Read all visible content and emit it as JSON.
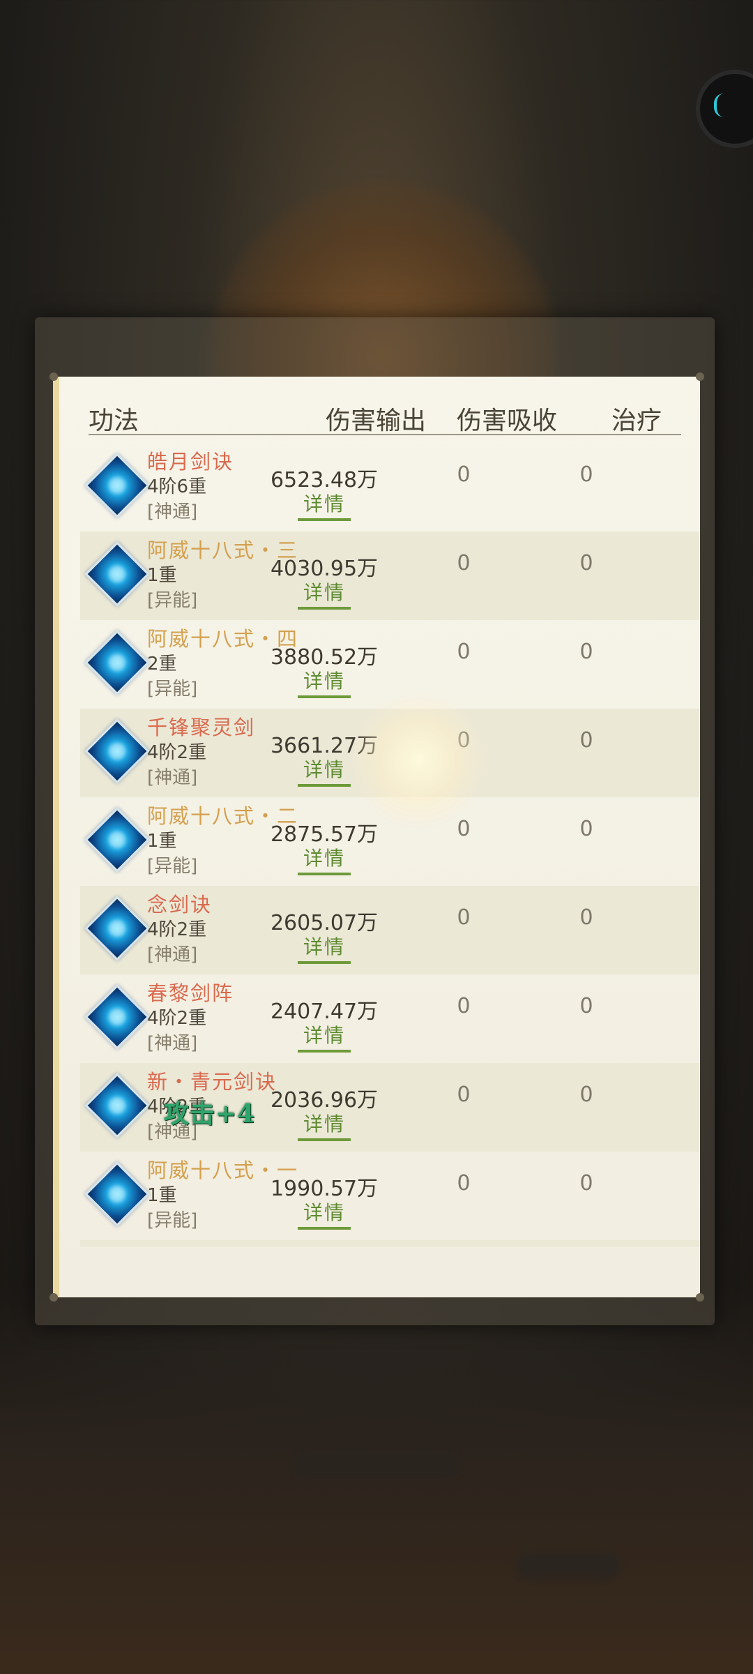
{
  "header": {
    "col_name": "功法",
    "col_damage": "伤害输出",
    "col_absorb": "伤害吸收",
    "col_heal": "治疗"
  },
  "rows": [
    {
      "name": "皓月剑诀",
      "name_color": "red",
      "level": "4阶6重",
      "type": "[神通]",
      "damage": "6523.48万",
      "detail": "详情",
      "absorb": "0",
      "heal": "0"
    },
    {
      "name": "阿威十八式・三",
      "name_color": "gold",
      "level": "1重",
      "type": "[异能]",
      "damage": "4030.95万",
      "detail": "详情",
      "absorb": "0",
      "heal": "0"
    },
    {
      "name": "阿威十八式・四",
      "name_color": "gold",
      "level": "2重",
      "type": "[异能]",
      "damage": "3880.52万",
      "detail": "详情",
      "absorb": "0",
      "heal": "0"
    },
    {
      "name": "千锋聚灵剑",
      "name_color": "red",
      "level": "4阶2重",
      "type": "[神通]",
      "damage": "3661.27万",
      "detail": "详情",
      "absorb": "0",
      "heal": "0"
    },
    {
      "name": "阿威十八式・二",
      "name_color": "gold",
      "level": "1重",
      "type": "[异能]",
      "damage": "2875.57万",
      "detail": "详情",
      "absorb": "0",
      "heal": "0"
    },
    {
      "name": "念剑诀",
      "name_color": "red",
      "level": "4阶2重",
      "type": "[神通]",
      "damage": "2605.07万",
      "detail": "详情",
      "absorb": "0",
      "heal": "0"
    },
    {
      "name": "春黎剑阵",
      "name_color": "red",
      "level": "4阶2重",
      "type": "[神通]",
      "damage": "2407.47万",
      "detail": "详情",
      "absorb": "0",
      "heal": "0"
    },
    {
      "name": "新・青元剑诀",
      "name_color": "red",
      "level": "4阶2重",
      "type": "[神通]",
      "damage": "2036.96万",
      "detail": "详情",
      "absorb": "0",
      "heal": "0"
    },
    {
      "name": "阿威十八式・一",
      "name_color": "gold",
      "level": "1重",
      "type": "[异能]",
      "damage": "1990.57万",
      "detail": "详情",
      "absorb": "0",
      "heal": "0"
    }
  ],
  "floating_text": "攻击+4"
}
